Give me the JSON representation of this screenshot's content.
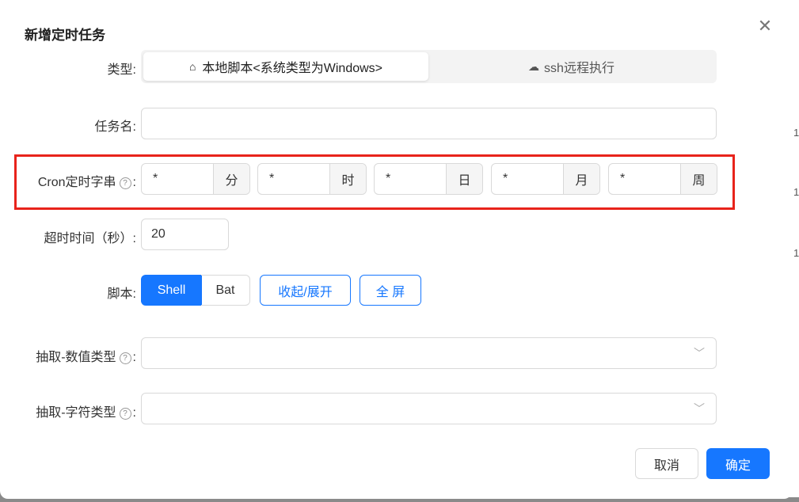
{
  "dialog": {
    "title": "新增定时任务",
    "close_icon": "close-icon"
  },
  "type": {
    "label": "类型:",
    "options": [
      {
        "label": "本地脚本<系统类型为Windows>",
        "icon": "home-icon",
        "selected": true
      },
      {
        "label": "ssh远程执行",
        "icon": "cloud-icon",
        "selected": false
      }
    ]
  },
  "task_name": {
    "label": "任务名:",
    "value": ""
  },
  "cron": {
    "label": "Cron定时字串",
    "colon": ":",
    "fields": [
      {
        "value": "*",
        "unit": "分"
      },
      {
        "value": "*",
        "unit": "时"
      },
      {
        "value": "*",
        "unit": "日"
      },
      {
        "value": "*",
        "unit": "月"
      },
      {
        "value": "*",
        "unit": "周"
      }
    ]
  },
  "timeout": {
    "label": "超时时间（秒）:",
    "value": "20"
  },
  "script": {
    "label": "脚本:",
    "options": [
      "Shell",
      "Bat"
    ],
    "selected": "Shell",
    "toggle_label": "收起/展开",
    "fullscreen_label": "全 屏"
  },
  "extract_number": {
    "label": "抽取-数值类型",
    "colon": ":",
    "value": ""
  },
  "extract_string": {
    "label": "抽取-字符类型",
    "colon": ":",
    "value": ""
  },
  "footer": {
    "cancel": "取消",
    "ok": "确定"
  },
  "colors": {
    "primary": "#1677ff",
    "highlight": "#e8231b"
  }
}
